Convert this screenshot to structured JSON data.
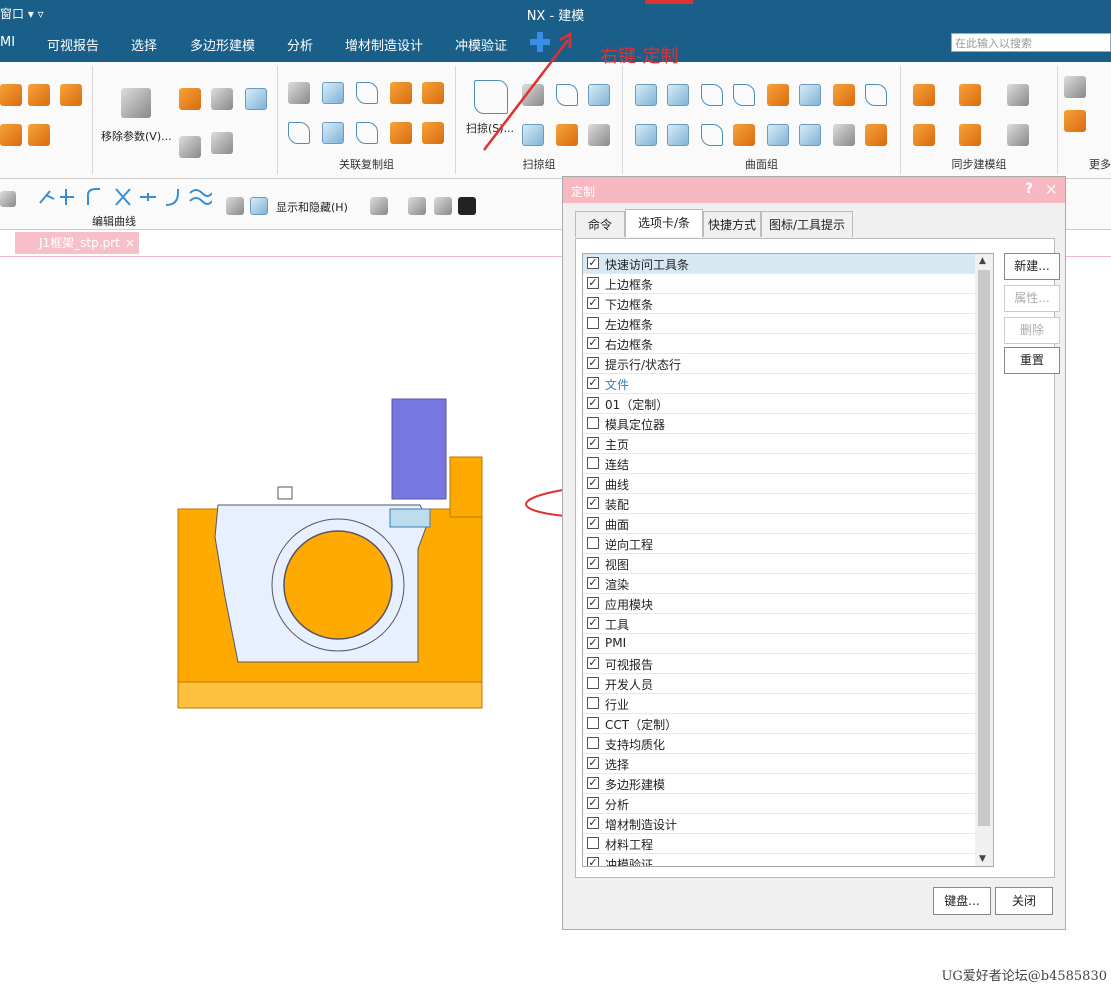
{
  "titlebar": {
    "window_menu": "窗口 ▾ ▿",
    "title": "NX - 建模"
  },
  "menu": {
    "tabs": [
      "MI",
      "可视报告",
      "选择",
      "多边形建模",
      "分析",
      "增材制造设计",
      "冲模验证"
    ]
  },
  "search": {
    "placeholder": "在此输入以搜索"
  },
  "annotation": {
    "text": "右键-定制"
  },
  "ribbon": {
    "remove_params": "移除参数(V)...",
    "sweep": "扫掠(S)...",
    "groups": [
      "关联复制组",
      "扫掠组",
      "曲面组",
      "同步建模组",
      "更多"
    ]
  },
  "toolbar2": {
    "edit_curve": "编辑曲线",
    "show_hide": "显示和隐藏(H)"
  },
  "doc_tab": {
    "label": "J1框架_stp.prt",
    "close": "×"
  },
  "dialog": {
    "title": "定制",
    "help": "?",
    "close": "×",
    "tabs": [
      "命令",
      "选项卡/条",
      "快捷方式",
      "图标/工具提示"
    ],
    "items": [
      {
        "label": "快速访问工具条",
        "checked": true
      },
      {
        "label": "上边框条",
        "checked": true
      },
      {
        "label": "下边框条",
        "checked": true
      },
      {
        "label": "左边框条",
        "checked": false
      },
      {
        "label": "右边框条",
        "checked": true
      },
      {
        "label": "提示行/状态行",
        "checked": true
      },
      {
        "label": "文件",
        "checked": true
      },
      {
        "label": "01（定制）",
        "checked": true
      },
      {
        "label": "模具定位器",
        "checked": false
      },
      {
        "label": "主页",
        "checked": true
      },
      {
        "label": "连结",
        "checked": false
      },
      {
        "label": "曲线",
        "checked": true
      },
      {
        "label": "装配",
        "checked": true
      },
      {
        "label": "曲面",
        "checked": true
      },
      {
        "label": "逆向工程",
        "checked": false
      },
      {
        "label": "视图",
        "checked": true
      },
      {
        "label": "渲染",
        "checked": true
      },
      {
        "label": "应用模块",
        "checked": true
      },
      {
        "label": "工具",
        "checked": true
      },
      {
        "label": "PMI",
        "checked": true
      },
      {
        "label": "可视报告",
        "checked": true
      },
      {
        "label": "开发人员",
        "checked": false
      },
      {
        "label": "行业",
        "checked": false
      },
      {
        "label": "CCT（定制）",
        "checked": false
      },
      {
        "label": "支持均质化",
        "checked": false
      },
      {
        "label": "选择",
        "checked": true
      },
      {
        "label": "多边形建模",
        "checked": true
      },
      {
        "label": "分析",
        "checked": true
      },
      {
        "label": "增材制造设计",
        "checked": true
      },
      {
        "label": "材料工程",
        "checked": false
      },
      {
        "label": "冲模验证",
        "checked": true
      }
    ],
    "side_buttons": [
      "新建...",
      "属性...",
      "删除",
      "重置"
    ],
    "bottom_buttons": [
      "键盘...",
      "关闭"
    ]
  },
  "watermark": "UG爱好者论坛@b4585830"
}
